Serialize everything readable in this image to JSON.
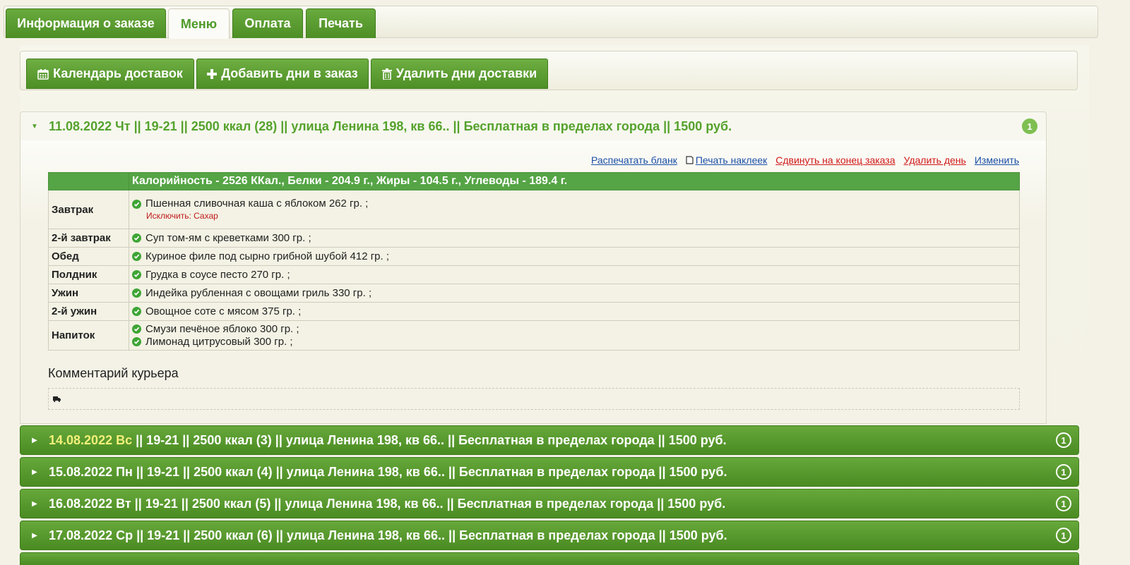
{
  "tabs": [
    {
      "label": "Информация о заказе",
      "active": false
    },
    {
      "label": "Меню",
      "active": true
    },
    {
      "label": "Оплата",
      "active": false
    },
    {
      "label": "Печать",
      "active": false
    }
  ],
  "toolbar": {
    "calendar_label": "Календарь доставок",
    "add_days_label": "Добавить дни в заказ",
    "delete_days_label": "Удалить дни доставки"
  },
  "open_day": {
    "date": "11.08.2022 Чт",
    "rest": " || 19-21 || 2500 ккал (28) || улица Ленина 198, кв 66.. || Бесплатная в пределах города || 1500 руб.",
    "badge": "1",
    "links": {
      "print_form": "Распечатать бланк",
      "print_labels": "Печать наклеек",
      "move_to_end": "Сдвинуть на конец заказа",
      "delete_day": "Удалить день",
      "edit": "Изменить"
    },
    "nutrition": "Калорийность - 2526 ККал., Белки - 204.9 г., Жиры - 104.5 г., Углеводы - 189.4 г.",
    "meals": [
      {
        "name": "Завтрак",
        "items": [
          "Пшенная сливочная каша с яблоком 262 гр. ;"
        ],
        "exclude": "Исключить: Сахар"
      },
      {
        "name": "2-й завтрак",
        "items": [
          "Суп том-ям с креветками 300 гр. ;"
        ]
      },
      {
        "name": "Обед",
        "items": [
          "Куриное филе под сырно грибной шубой 412 гр. ;"
        ]
      },
      {
        "name": "Полдник",
        "items": [
          "Грудка в соусе песто 270 гр. ;"
        ]
      },
      {
        "name": "Ужин",
        "items": [
          "Индейка рубленная с овощами гриль 330 гр. ;"
        ]
      },
      {
        "name": "2-й ужин",
        "items": [
          "Овощное соте с мясом 375 гр. ;"
        ]
      },
      {
        "name": "Напиток",
        "items": [
          "Смузи печёное яблоко 300 гр. ;",
          "Лимонад цитрусовый 300 гр. ;"
        ]
      }
    ],
    "courier_comment_title": "Комментарий курьера",
    "courier_comment_icon": "truck-icon"
  },
  "days": [
    {
      "date": "14.08.2022 Вс",
      "rest": " || 19-21 || 2500 ккал (3) || улица Ленина 198, кв 66.. || Бесплатная в пределах города || 1500 руб.",
      "badge": "1",
      "highlight": true
    },
    {
      "date": "15.08.2022 Пн",
      "rest": " || 19-21 || 2500 ккал (4) || улица Ленина 198, кв 66.. || Бесплатная в пределах города || 1500 руб.",
      "badge": "1",
      "highlight": false
    },
    {
      "date": "16.08.2022 Вт",
      "rest": " || 19-21 || 2500 ккал (5) || улица Ленина 198, кв 66.. || Бесплатная в пределах города || 1500 руб.",
      "badge": "1",
      "highlight": false
    },
    {
      "date": "17.08.2022 Ср",
      "rest": " || 19-21 || 2500 ккал (6) || улица Ленина 198, кв 66.. || Бесплатная в пределах города || 1500 руб.",
      "badge": "1",
      "highlight": false
    }
  ],
  "colors": {
    "accent": "#55a22c",
    "button": "#5a9b31",
    "link_blue": "#1a4fa6",
    "link_red": "#d01818",
    "highlight": "#f3f07a"
  }
}
